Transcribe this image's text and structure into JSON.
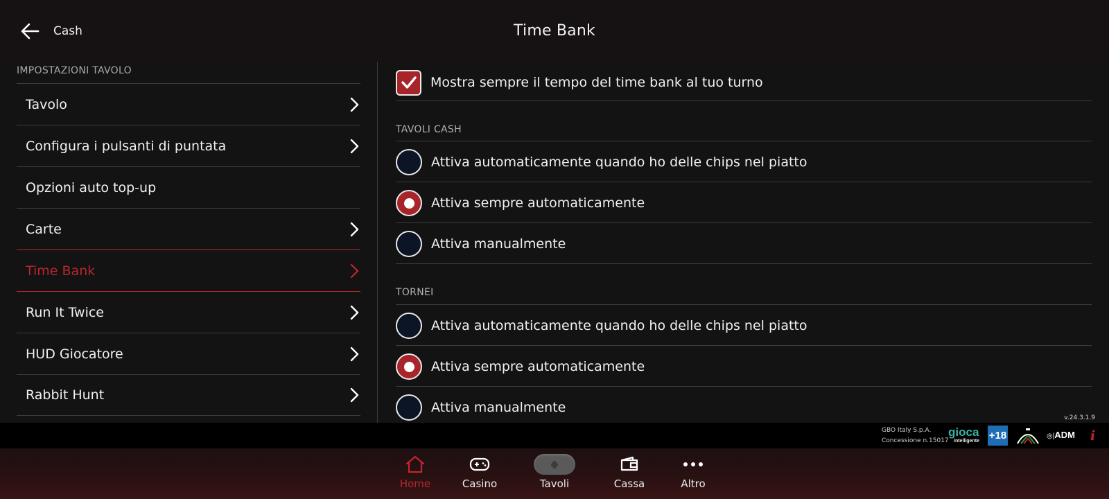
{
  "header": {
    "back_label": "Cash",
    "title": "Time Bank"
  },
  "sidebar": {
    "section_title": "IMPOSTAZIONI TAVOLO",
    "items": [
      {
        "label": "Tavolo",
        "has_chevron": true
      },
      {
        "label": "Configura i pulsanti di puntata",
        "has_chevron": true
      },
      {
        "label": "Opzioni auto top-up",
        "has_chevron": false
      },
      {
        "label": "Carte",
        "has_chevron": true
      },
      {
        "label": "Time Bank",
        "has_chevron": true,
        "active": true
      },
      {
        "label": "Run It Twice",
        "has_chevron": true
      },
      {
        "label": "HUD Giocatore",
        "has_chevron": true
      },
      {
        "label": "Rabbit Hunt",
        "has_chevron": true
      }
    ]
  },
  "main": {
    "show_timebank_checkbox": {
      "label": "Mostra sempre il tempo del time bank al tuo turno",
      "checked": true
    },
    "cash_group": {
      "title": "TAVOLI CASH",
      "options": [
        {
          "label": "Attiva automaticamente quando ho delle chips nel piatto",
          "selected": false
        },
        {
          "label": "Attiva sempre automaticamente",
          "selected": true
        },
        {
          "label": "Attiva manualmente",
          "selected": false
        }
      ]
    },
    "tournament_group": {
      "title": "TORNEI",
      "options": [
        {
          "label": "Attiva automaticamente quando ho delle chips nel piatto",
          "selected": false
        },
        {
          "label": "Attiva sempre automaticamente",
          "selected": true
        },
        {
          "label": "Attiva manualmente",
          "selected": false
        }
      ]
    }
  },
  "footer": {
    "version": "v.24.3.1.9",
    "company": "GBO Italy S.p.A.",
    "concession": "Concessione n.15017",
    "gioca_logo": "gioca",
    "gioca_sub": "intelligente",
    "age_badge": "+18",
    "adm_label": "ADM",
    "info_icon": "i"
  },
  "bottom_nav": [
    {
      "label": "Home",
      "icon": "home-icon",
      "active": true
    },
    {
      "label": "Casino",
      "icon": "gamepad-icon",
      "active": false
    },
    {
      "label": "Tavoli",
      "icon": "poker-chip-icon",
      "active": false
    },
    {
      "label": "Cassa",
      "icon": "wallet-icon",
      "active": false
    },
    {
      "label": "Altro",
      "icon": "more-icon",
      "active": false
    }
  ],
  "colors": {
    "accent": "#c0272d",
    "radio_unselected": "#0b1526",
    "background": "#131313"
  }
}
